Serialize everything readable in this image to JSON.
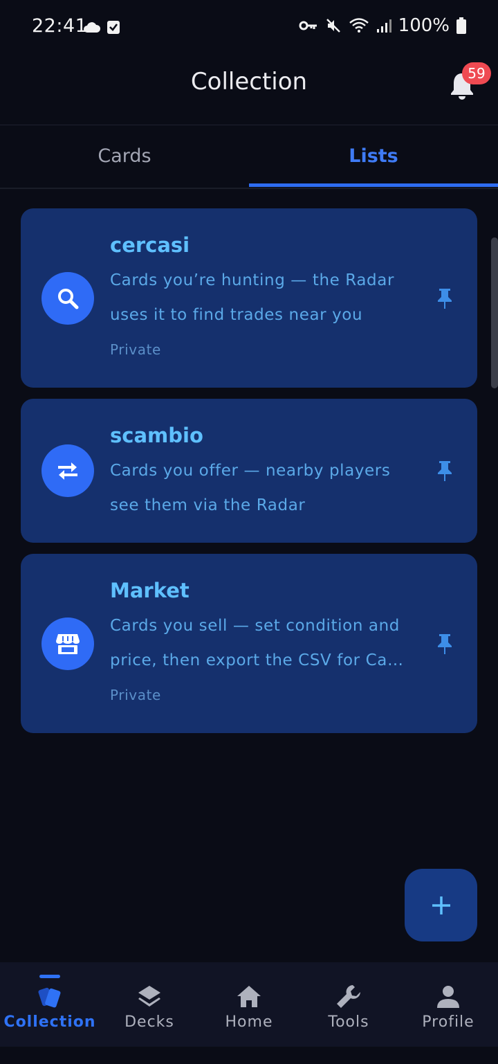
{
  "status_bar": {
    "time": "22:41",
    "battery": "100%",
    "icons": [
      "cloud-icon",
      "checkbox-icon",
      "vpn-key-icon",
      "mute-icon",
      "wifi-icon",
      "signal-icon",
      "battery-icon"
    ]
  },
  "header": {
    "title": "Collection",
    "notification_count": "59"
  },
  "tabs": [
    {
      "label": "Cards",
      "active": false
    },
    {
      "label": "Lists",
      "active": true
    }
  ],
  "lists": [
    {
      "name": "cercasi",
      "icon": "search-icon",
      "description_lines": [
        "Cards you’re hunting — the Radar",
        "uses it to find trades near you"
      ],
      "privacy": "Private",
      "pinned": true
    },
    {
      "name": "scambio",
      "icon": "swap-icon",
      "description_lines": [
        "Cards you offer — nearby players",
        "see them via the Radar"
      ],
      "privacy": "",
      "pinned": true
    },
    {
      "name": "Market",
      "icon": "store-icon",
      "description_lines": [
        "Cards you sell — set condition and",
        "price, then export the CSV for Ca…"
      ],
      "privacy": "Private",
      "pinned": true
    }
  ],
  "fab": {
    "icon": "plus-icon"
  },
  "bottom_nav": [
    {
      "label": "Collection",
      "icon": "cards-icon",
      "active": true
    },
    {
      "label": "Decks",
      "icon": "layers-icon",
      "active": false
    },
    {
      "label": "Home",
      "icon": "home-icon",
      "active": false
    },
    {
      "label": "Tools",
      "icon": "wrench-icon",
      "active": false
    },
    {
      "label": "Profile",
      "icon": "person-icon",
      "active": false
    }
  ],
  "colors": {
    "background": "#0a0c16",
    "card": "#15306d",
    "accent": "#2f6bf6",
    "title": "#5fc0ff",
    "badge": "#ef4a52"
  }
}
